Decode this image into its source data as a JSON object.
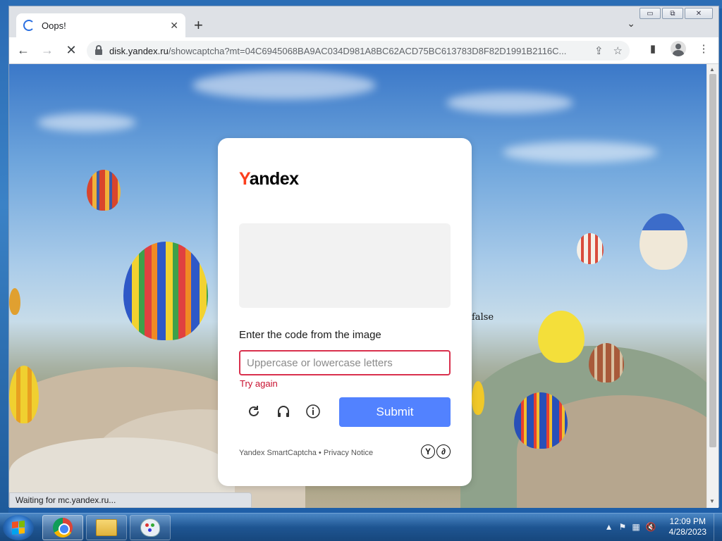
{
  "browser": {
    "tab_title": "Oops!",
    "url_domain": "disk.yandex.ru",
    "url_rest": "/showcaptcha?mt=04C6945068BA9AC034D981A8BC62ACD75BC613783D8F82D1991B2116C...",
    "status_text": "Waiting for mc.yandex.ru..."
  },
  "captcha": {
    "logo_y": "Y",
    "logo_rest": "andex",
    "prompt": "Enter the code from the image",
    "input_placeholder": "Uppercase or lowercase letters",
    "input_value": "",
    "error": "Try again",
    "submit_label": "Submit",
    "footer": "Yandex SmartCaptcha • Privacy Notice",
    "footer_logo_1": "Y",
    "footer_logo_2": "∂"
  },
  "stray_text": "false",
  "taskbar": {
    "time": "12:09 PM",
    "date": "4/28/2023"
  },
  "colors": {
    "submit": "#5282ff",
    "error": "#c8102e",
    "logo_accent": "#fc3f1d"
  }
}
